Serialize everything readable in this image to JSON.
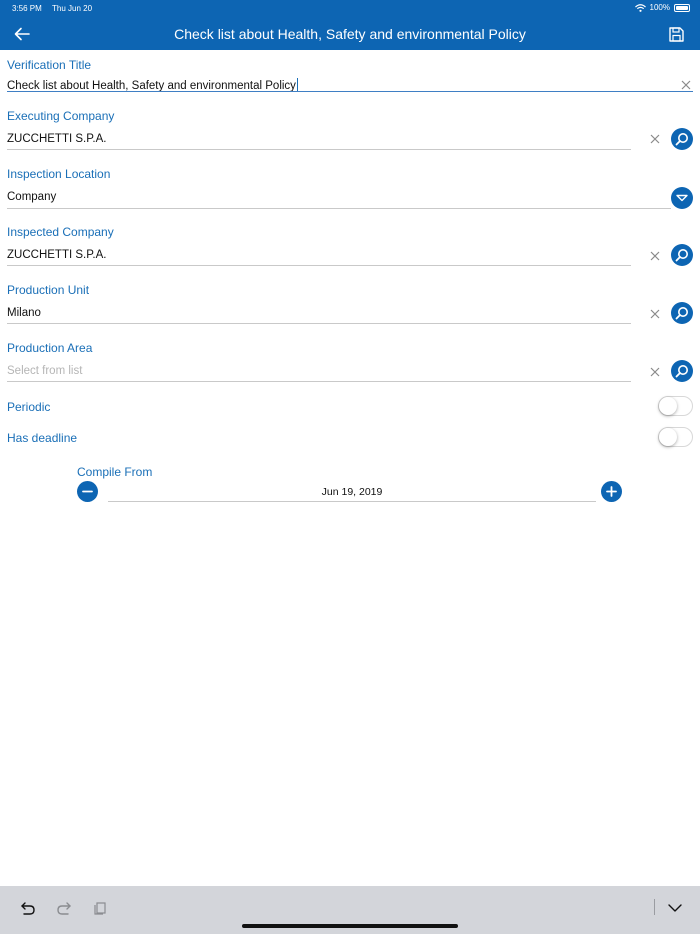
{
  "status_bar": {
    "time": "3:56 PM",
    "date": "Thu Jun 20",
    "battery": "100%",
    "wifi_icon": "wifi-icon",
    "battery_icon": "battery-icon"
  },
  "header": {
    "title": "Check list about Health, Safety and environmental Policy",
    "back_icon": "arrow-left-icon",
    "save_icon": "floppy-disk-icon",
    "background": "#0d65b3"
  },
  "form": {
    "verification_title": {
      "label": "Verification Title",
      "value": "Check list about Health, Safety and environmental Policy"
    },
    "executing_company": {
      "label": "Executing Company",
      "value": "ZUCCHETTI S.P.A."
    },
    "inspection_location": {
      "label": "Inspection Location",
      "value": "Company"
    },
    "inspected_company": {
      "label": "Inspected Company",
      "value": "ZUCCHETTI S.P.A."
    },
    "production_unit": {
      "label": "Production Unit",
      "value": "Milano"
    },
    "production_area": {
      "label": "Production Area",
      "value": "",
      "placeholder": "Select from list"
    },
    "periodic": {
      "label": "Periodic",
      "checked": false
    },
    "has_deadline": {
      "label": "Has deadline",
      "checked": false
    },
    "compile_from": {
      "label": "Compile From",
      "value": "Jun 19, 2019"
    }
  },
  "keyboard_bar": {
    "undo_icon": "undo-icon",
    "redo_icon": "redo-icon",
    "paste_icon": "clipboard-icon",
    "dismiss_icon": "chevron-down-icon"
  },
  "colors": {
    "accent": "#0d65b3",
    "label": "#1a6fb7",
    "keyboard_bar": "#d3d5da"
  }
}
